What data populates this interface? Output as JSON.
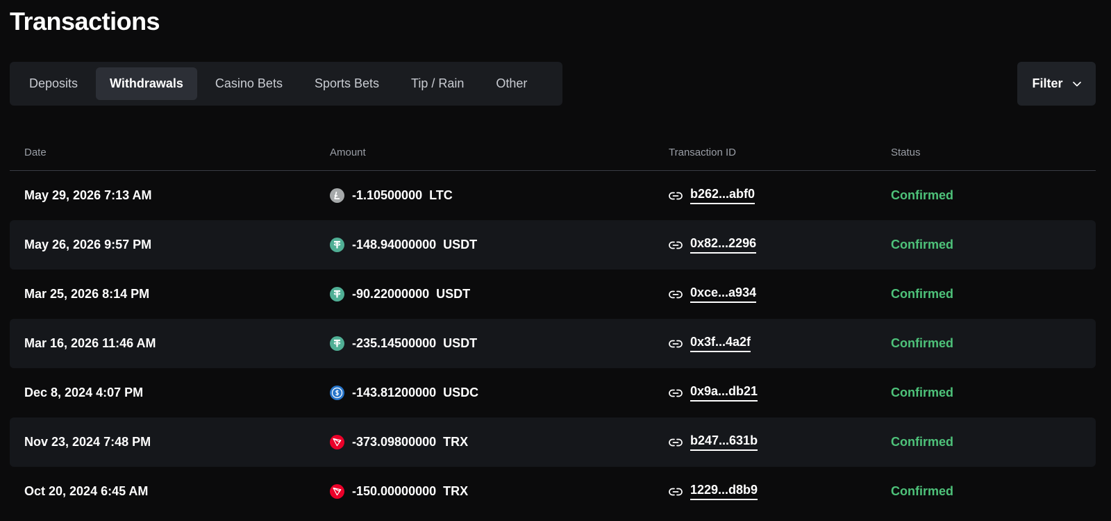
{
  "page_title": "Transactions",
  "tabs": [
    {
      "label": "Deposits",
      "active": false
    },
    {
      "label": "Withdrawals",
      "active": true
    },
    {
      "label": "Casino Bets",
      "active": false
    },
    {
      "label": "Sports Bets",
      "active": false
    },
    {
      "label": "Tip / Rain",
      "active": false
    },
    {
      "label": "Other",
      "active": false
    }
  ],
  "filter": {
    "label": "Filter",
    "icon": "chevron-down-icon"
  },
  "table": {
    "headers": {
      "date": "Date",
      "amount": "Amount",
      "txid": "Transaction ID",
      "status": "Status"
    },
    "rows": [
      {
        "date": "May 29, 2026 7:13 AM",
        "amount": "-1.10500000",
        "currency": "LTC",
        "icon": "ltc-icon",
        "txid": "b262...abf0",
        "status": "Confirmed"
      },
      {
        "date": "May 26, 2026 9:57 PM",
        "amount": "-148.94000000",
        "currency": "USDT",
        "icon": "usdt-icon",
        "txid": "0x82...2296",
        "status": "Confirmed"
      },
      {
        "date": "Mar 25, 2026 8:14 PM",
        "amount": "-90.22000000",
        "currency": "USDT",
        "icon": "usdt-icon",
        "txid": "0xce...a934",
        "status": "Confirmed"
      },
      {
        "date": "Mar 16, 2026 11:46 AM",
        "amount": "-235.14500000",
        "currency": "USDT",
        "icon": "usdt-icon",
        "txid": "0x3f...4a2f",
        "status": "Confirmed"
      },
      {
        "date": "Dec 8, 2024 4:07 PM",
        "amount": "-143.81200000",
        "currency": "USDC",
        "icon": "usdc-icon",
        "txid": "0x9a...db21",
        "status": "Confirmed"
      },
      {
        "date": "Nov 23, 2024 7:48 PM",
        "amount": "-373.09800000",
        "currency": "TRX",
        "icon": "trx-icon",
        "txid": "b247...631b",
        "status": "Confirmed"
      },
      {
        "date": "Oct 20, 2024 6:45 AM",
        "amount": "-150.00000000",
        "currency": "TRX",
        "icon": "trx-icon",
        "txid": "1229...d8b9",
        "status": "Confirmed"
      }
    ]
  },
  "colors": {
    "status_confirmed": "#4ec27a",
    "ltc": "#a6a9aa",
    "usdt": "#50af95",
    "usdc": "#2775ca",
    "trx": "#eb0029"
  }
}
